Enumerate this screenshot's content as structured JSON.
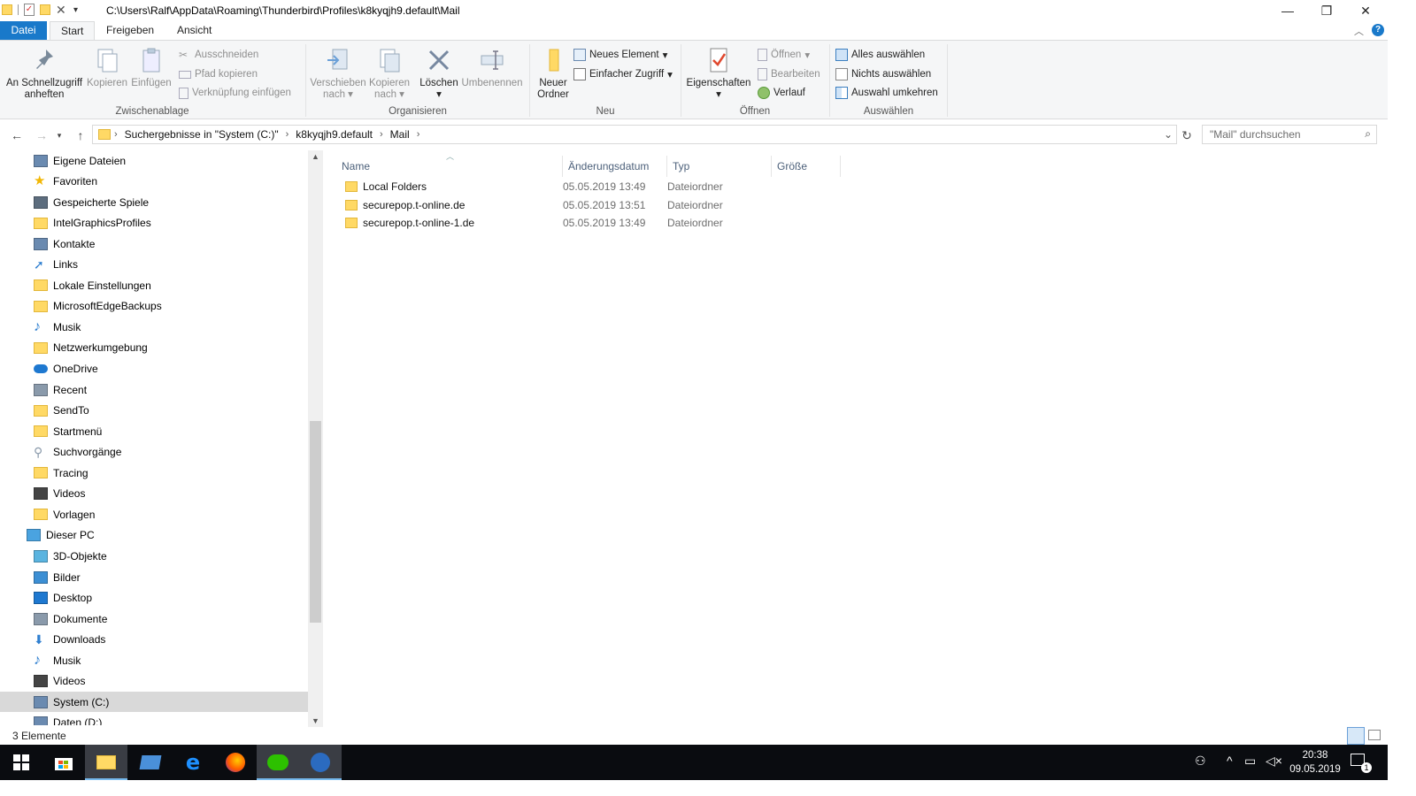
{
  "window": {
    "path_title": "C:\\Users\\Ralf\\AppData\\Roaming\\Thunderbird\\Profiles\\k8kyqjh9.default\\Mail"
  },
  "menu_tabs": [
    "Datei",
    "Start",
    "Freigeben",
    "Ansicht"
  ],
  "ribbon": {
    "clipboard": {
      "label": "Zwischenablage",
      "pin": "An Schnellzugriff anheften",
      "copy": "Kopieren",
      "paste": "Einfügen",
      "cut": "Ausschneiden",
      "copy_path": "Pfad kopieren",
      "paste_shortcut": "Verknüpfung einfügen"
    },
    "organize": {
      "label": "Organisieren",
      "move_to": "Verschieben nach",
      "copy_to": "Kopieren nach",
      "delete": "Löschen",
      "rename": "Umbenennen"
    },
    "new": {
      "label": "Neu",
      "new_folder": "Neuer Ordner",
      "new_item": "Neues Element",
      "easy_access": "Einfacher Zugriff"
    },
    "open": {
      "label": "Öffnen",
      "properties": "Eigenschaften",
      "open": "Öffnen",
      "edit": "Bearbeiten",
      "history": "Verlauf"
    },
    "select": {
      "label": "Auswählen",
      "select_all": "Alles auswählen",
      "select_none": "Nichts auswählen",
      "invert": "Auswahl umkehren"
    }
  },
  "address": {
    "crumbs": [
      "Suchergebnisse in \"System (C:)\"",
      "k8kyqjh9.default",
      "Mail"
    ],
    "search_placeholder": "\"Mail\" durchsuchen"
  },
  "nav_items": [
    {
      "label": "Eigene Dateien",
      "icon": "contacts-doc-icon"
    },
    {
      "label": "Favoriten",
      "icon": "star-icon"
    },
    {
      "label": "Gespeicherte Spiele",
      "icon": "games-icon"
    },
    {
      "label": "IntelGraphicsProfiles",
      "icon": "folder-icon"
    },
    {
      "label": "Kontakte",
      "icon": "contacts-icon"
    },
    {
      "label": "Links",
      "icon": "link-arrow-icon"
    },
    {
      "label": "Lokale Einstellungen",
      "icon": "folder-shortcut-icon"
    },
    {
      "label": "MicrosoftEdgeBackups",
      "icon": "folder-icon"
    },
    {
      "label": "Musik",
      "icon": "music-icon"
    },
    {
      "label": "Netzwerkumgebung",
      "icon": "folder-shortcut-icon"
    },
    {
      "label": "OneDrive",
      "icon": "cloud-icon"
    },
    {
      "label": "Recent",
      "icon": "recent-icon"
    },
    {
      "label": "SendTo",
      "icon": "folder-shortcut-icon"
    },
    {
      "label": "Startmenü",
      "icon": "folder-shortcut-icon"
    },
    {
      "label": "Suchvorgänge",
      "icon": "search-icon"
    },
    {
      "label": "Tracing",
      "icon": "folder-icon"
    },
    {
      "label": "Videos",
      "icon": "video-icon"
    },
    {
      "label": "Vorlagen",
      "icon": "folder-shortcut-icon"
    },
    {
      "label": "Dieser PC",
      "icon": "computer-icon"
    },
    {
      "label": "3D-Objekte",
      "icon": "cube-icon"
    },
    {
      "label": "Bilder",
      "icon": "pictures-icon"
    },
    {
      "label": "Desktop",
      "icon": "desktop-icon"
    },
    {
      "label": "Dokumente",
      "icon": "documents-icon"
    },
    {
      "label": "Downloads",
      "icon": "download-icon"
    },
    {
      "label": "Musik",
      "icon": "music-icon"
    },
    {
      "label": "Videos",
      "icon": "video-icon"
    },
    {
      "label": "System (C:)",
      "icon": "drive-icon"
    },
    {
      "label": "Daten (D:)",
      "icon": "drive-icon"
    }
  ],
  "columns": [
    "Name",
    "Änderungsdatum",
    "Typ",
    "Größe"
  ],
  "files": [
    {
      "name": "Local Folders",
      "date": "05.05.2019 13:49",
      "type": "Dateiordner",
      "size": ""
    },
    {
      "name": "securepop.t-online.de",
      "date": "05.05.2019 13:51",
      "type": "Dateiordner",
      "size": ""
    },
    {
      "name": "securepop.t-online-1.de",
      "date": "05.05.2019 13:49",
      "type": "Dateiordner",
      "size": ""
    }
  ],
  "status": {
    "count": "3 Elemente"
  },
  "taskbar": {
    "time": "20:38",
    "date": "09.05.2019",
    "notification_count": "1"
  },
  "colors": {
    "accent": "#1979ca",
    "selection": "#d9d9d9",
    "folder": "#ffd965",
    "taskbar": "#0a0c10"
  }
}
